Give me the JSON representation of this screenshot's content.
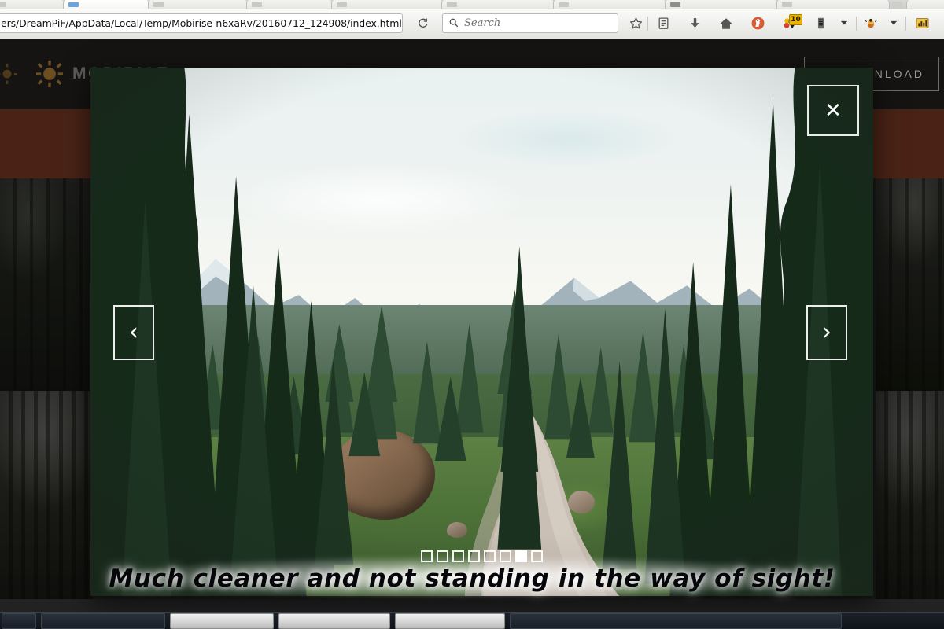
{
  "browser": {
    "url": "ers/DreamPiF/AppData/Local/Temp/Mobirise-n6xaRv/20160712_124908/index.html",
    "reload_icon": "reload-icon",
    "search": {
      "placeholder": "Search",
      "icon": "search-icon"
    },
    "toolbar_icons": [
      {
        "name": "bookmark-star-icon",
        "glyph": "☆"
      },
      {
        "name": "reading-list-icon",
        "glyph": "὜A"
      },
      {
        "name": "downloads-icon",
        "glyph": "↓"
      },
      {
        "name": "home-icon",
        "glyph": "⌂"
      },
      {
        "name": "duckduckgo-icon",
        "glyph": "●"
      },
      {
        "name": "extension-counter-icon",
        "glyph": "●",
        "badge": "10"
      },
      {
        "name": "server-extension-icon",
        "glyph": "▤"
      },
      {
        "name": "dropdown-caret-icon",
        "glyph": "▼"
      },
      {
        "name": "bug-extension-icon",
        "glyph": "●"
      },
      {
        "name": "dropdown-caret-icon-2",
        "glyph": "▼"
      },
      {
        "name": "stats-extension-icon",
        "glyph": "▦"
      }
    ]
  },
  "site": {
    "brand": "MOBIRISE",
    "logo_icon": "sun-gear-icon",
    "download_label": "DOWNLOAD",
    "download_icon": "download-arrow-icon"
  },
  "lightbox": {
    "close_label": "✕",
    "close_icon": "close-icon",
    "prev_label": "‹",
    "prev_icon": "chevron-left-icon",
    "next_label": "›",
    "next_icon": "chevron-right-icon",
    "slide_count": 8,
    "active_slide": 7,
    "image_alt": "Mountain range with evergreen forest and a gravel trail"
  },
  "caption": {
    "text": "Much cleaner and not standing in the way of sight!"
  },
  "colors": {
    "site_nav_bg": "#161412",
    "site_band": "#4a2316",
    "brand_text": "#5e5c59",
    "logo_gold": "#6b4f22",
    "badge_yellow": "#f0b400",
    "control_white": "#ffffff",
    "caption_text": "#07060a"
  },
  "taskbar": {
    "start_label": "",
    "tasks": [
      "",
      "",
      "",
      ""
    ]
  }
}
